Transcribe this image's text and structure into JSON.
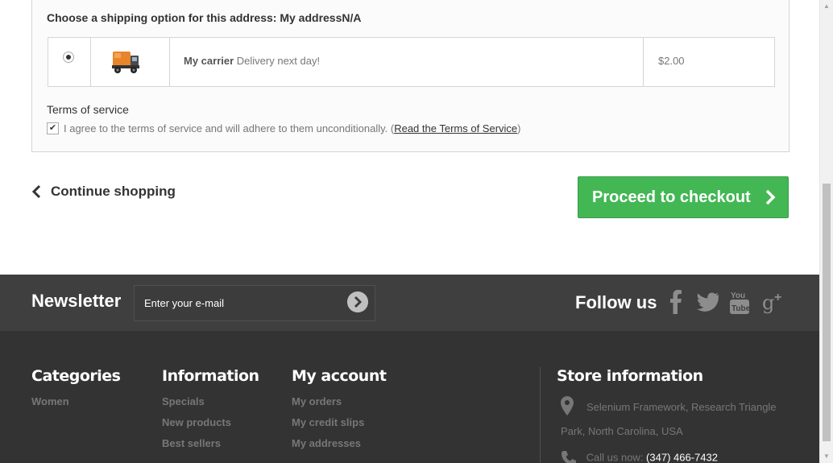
{
  "shipping": {
    "title": "Choose a shipping option for this address: My addressN/A",
    "carrier_name": "My carrier",
    "carrier_desc": " Delivery next day!",
    "price": "$2.00",
    "terms_heading": "Terms of service",
    "terms_text": "I agree to the terms of service and will adhere to them unconditionally. (",
    "terms_link": "Read the Terms of Service",
    "terms_close": ")",
    "checkbox_mark": "✔"
  },
  "navigation": {
    "continue_label": "Continue shopping",
    "checkout_label": "Proceed to checkout"
  },
  "newsletter": {
    "title": "Newsletter",
    "placeholder": "Enter your e-mail"
  },
  "follow": {
    "title": "Follow us",
    "icons": [
      "facebook-icon",
      "twitter-icon",
      "youtube-icon",
      "google-plus-icon"
    ]
  },
  "footer": {
    "categories": {
      "title": "Categories",
      "items": [
        "Women"
      ]
    },
    "information": {
      "title": "Information",
      "items": [
        "Specials",
        "New products",
        "Best sellers"
      ]
    },
    "account": {
      "title": "My account",
      "items": [
        "My orders",
        "My credit slips",
        "My addresses"
      ]
    },
    "store": {
      "title": "Store information",
      "address": "Selenium Framework, Research Triangle Park, North Carolina, USA",
      "phone_label": "Call us now: ",
      "phone": "(347) 466-7432"
    }
  },
  "colors": {
    "checkout_green": "#43b754",
    "footer_dark": "#333333",
    "newsletter_band": "#3f3f3f"
  }
}
